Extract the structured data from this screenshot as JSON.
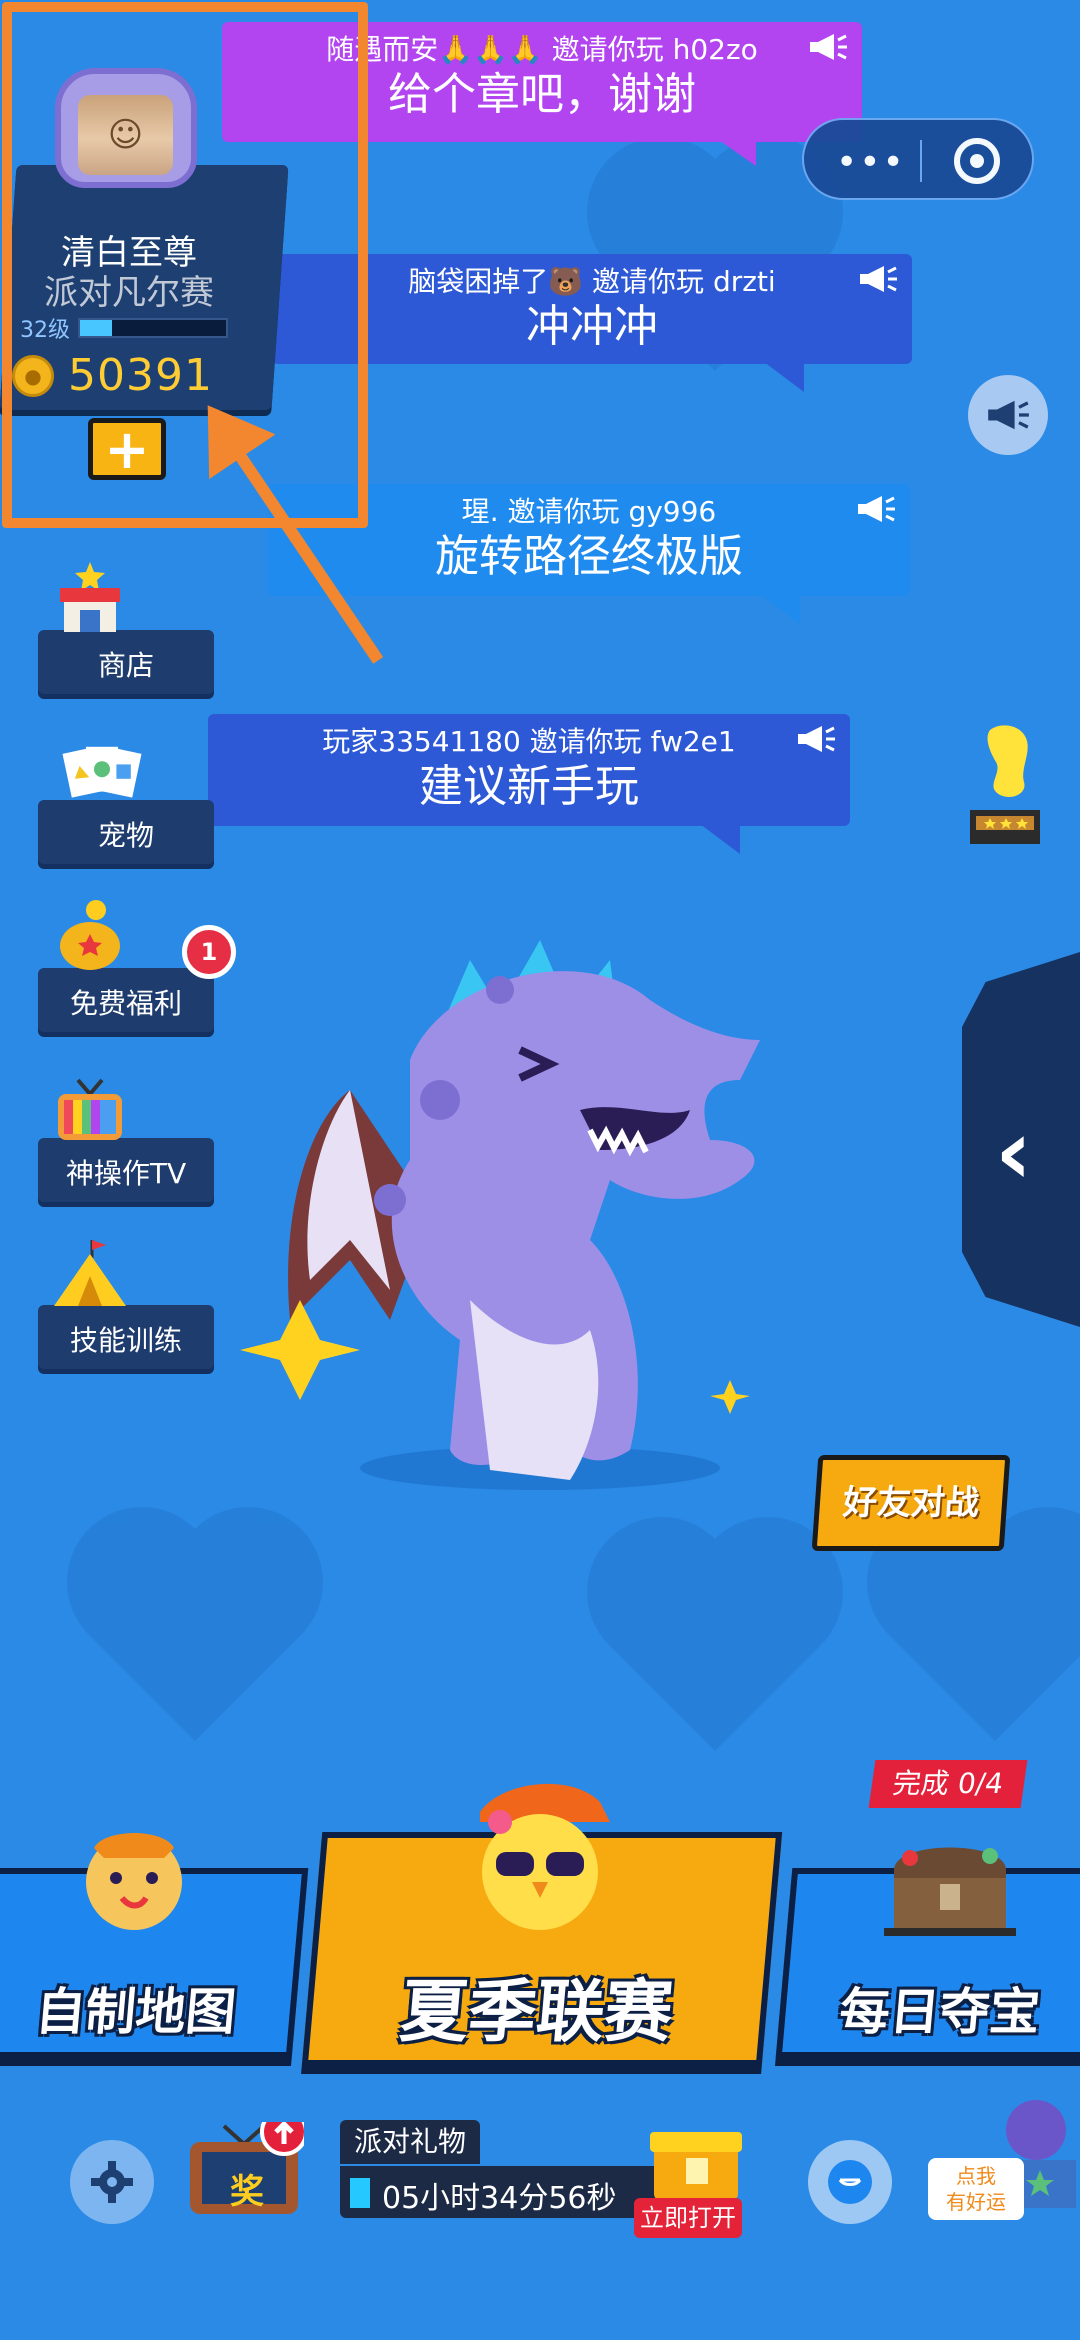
{
  "profile": {
    "name": "清白至尊",
    "title": "派对凡尔赛",
    "level_label": "32级",
    "level_progress": 0.22,
    "coins": "50391",
    "add_label": "+"
  },
  "mini_program_capsule": {
    "more_label": "•••"
  },
  "banners": [
    {
      "invite": "随遇而安🙏🙏🙏 邀请你玩 h02zo",
      "name": "给个章吧，谢谢",
      "color": "#b345f0"
    },
    {
      "invite": "脑袋困掉了🐻 邀请你玩 drzti",
      "name": "冲冲冲",
      "color": "#2e59d6"
    },
    {
      "invite": "瑆. 邀请你玩 gy996",
      "name": "旋转路径终极版",
      "color": "#1f8bee"
    },
    {
      "invite": "玩家33541180 邀请你玩 fw2e1",
      "name": "建议新手玩",
      "color": "#2e59d6"
    }
  ],
  "menu": [
    {
      "label": "商店",
      "icon": "shop-icon"
    },
    {
      "label": "宠物",
      "icon": "pet-cards-icon"
    },
    {
      "label": "免费福利",
      "icon": "piggy-bank-icon",
      "badge": "1"
    },
    {
      "label": "神操作TV",
      "icon": "tv-icon"
    },
    {
      "label": "技能训练",
      "icon": "tent-icon"
    }
  ],
  "friend_battle_label": "好友对战",
  "modes": {
    "custom_map": "自制地图",
    "summer_league": "夏季联赛",
    "daily_treasure": "每日夺宝",
    "task_progress": "完成 0/4"
  },
  "bottom": {
    "reward_label": "奖",
    "gift_title": "派对礼物",
    "gift_timer": "05小时34分56秒",
    "open_now": "立即打开",
    "lucky_text_1": "点我",
    "lucky_text_2": "有好运"
  },
  "colors": {
    "background": "#2a8ae6",
    "accent_orange": "#f2872f",
    "button_yellow": "#f6aa10",
    "coin_text": "#ffcc33",
    "badge_red": "#e4213b"
  }
}
